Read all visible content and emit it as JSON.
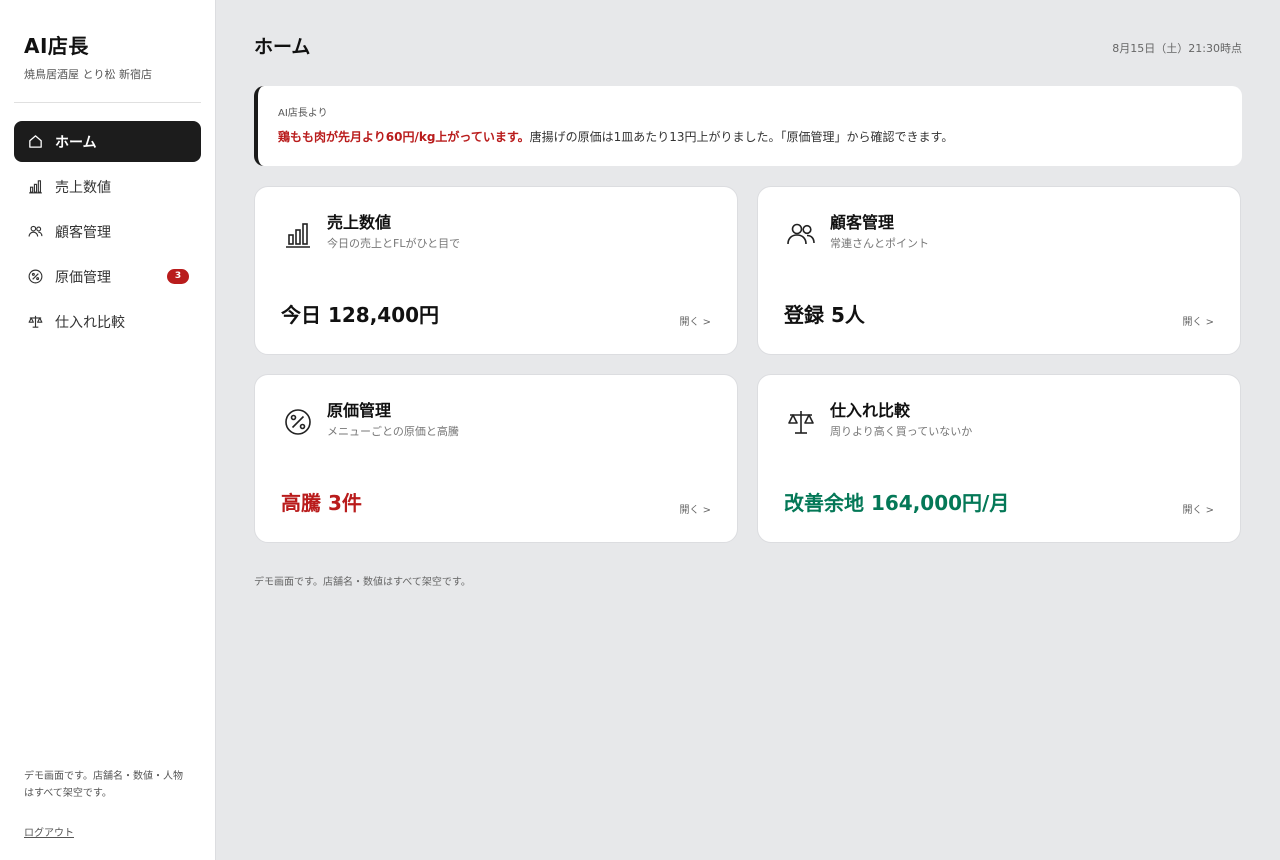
{
  "sidebar": {
    "brand_title": "AI店長",
    "brand_sub": "焼鳥居酒屋 とり松 新宿店",
    "items": [
      {
        "label": "ホーム",
        "icon": "home-icon",
        "active": true
      },
      {
        "label": "売上数値",
        "icon": "bar-chart-icon"
      },
      {
        "label": "顧客管理",
        "icon": "users-icon"
      },
      {
        "label": "原価管理",
        "icon": "percent-icon",
        "badge": "3"
      },
      {
        "label": "仕入れ比較",
        "icon": "scale-icon"
      }
    ],
    "footer_note": "デモ画面です。店舗名・数値・人物はすべて架空です。",
    "logout_label": "ログアウト"
  },
  "header": {
    "title": "ホーム",
    "timestamp": "8月15日（土）21:30時点"
  },
  "notice": {
    "label": "AI店長より",
    "highlight": "鶏もも肉が先月より60円/kg上がっています。",
    "text": "唐揚げの原価は1皿あたり13円上がりました。「原価管理」から確認できます。"
  },
  "cards": [
    {
      "title": "売上数値",
      "subtitle": "今日の売上とFLがひと目で",
      "value": "今日 128,400円",
      "open_label": "開く >",
      "icon": "bar-chart-icon"
    },
    {
      "title": "顧客管理",
      "subtitle": "常連さんとポイント",
      "value": "登録 5人",
      "open_label": "開く >",
      "icon": "users-icon"
    },
    {
      "title": "原価管理",
      "subtitle": "メニューごとの原価と高騰",
      "value": "高騰 3件",
      "open_label": "開く >",
      "icon": "percent-icon",
      "value_color": "#b91c1c"
    },
    {
      "title": "仕入れ比較",
      "subtitle": "周りより高く買っていないか",
      "value": "改善余地 164,000円/月",
      "open_label": "開く >",
      "icon": "scale-icon",
      "value_color": "#047857"
    }
  ],
  "footnote": "デモ画面です。店舗名・数値はすべて架空です。",
  "colors": {
    "accent_dark": "#1c1c1c",
    "alert_red": "#b91c1c",
    "positive_green": "#047857"
  }
}
